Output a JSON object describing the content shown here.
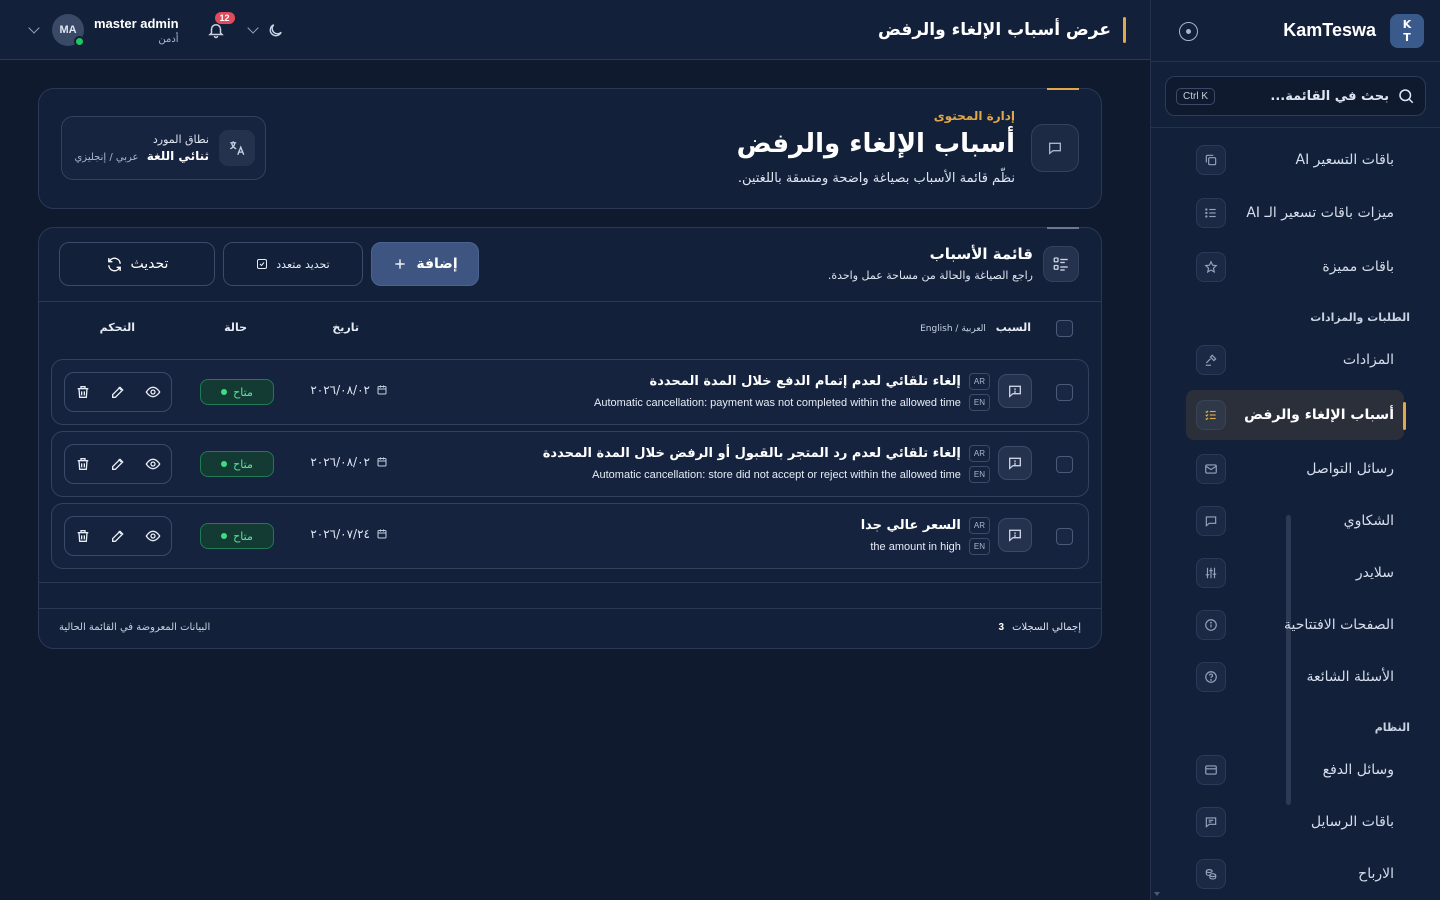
{
  "brand": {
    "logo_line1": "K",
    "logo_line2": "T",
    "name": "KamTeswa"
  },
  "sidebar": {
    "search_placeholder": "بحث في القائمة...",
    "search_shortcut": "Ctrl K",
    "items": [
      {
        "label": "باقات التسعير AI",
        "icon": "copy-icon"
      },
      {
        "label": "ميزات باقات تسعير الـ AI",
        "icon": "list-icon"
      },
      {
        "label": "باقات مميزة",
        "icon": "star-icon"
      },
      {
        "label": "المزادات",
        "icon": "gavel-icon"
      },
      {
        "label": "أسباب الإلغاء والرفض",
        "icon": "list-check-icon",
        "active": true
      },
      {
        "label": "رسائل التواصل",
        "icon": "mail-icon"
      },
      {
        "label": "الشكاوي",
        "icon": "chat-icon"
      },
      {
        "label": "سلايدر",
        "icon": "sliders-icon"
      },
      {
        "label": "الصفحات الافتتاحية",
        "icon": "info-icon"
      },
      {
        "label": "الأسئلة الشائعة",
        "icon": "question-icon"
      },
      {
        "label": "وسائل الدفع",
        "icon": "card-icon"
      },
      {
        "label": "باقات الرسايل",
        "icon": "message-icon"
      },
      {
        "label": "الارباح",
        "icon": "coins-icon"
      }
    ],
    "sections": {
      "orders": "الطلبات والمزادات",
      "system": "النظام"
    }
  },
  "header": {
    "page_title": "عرض أسباب الإلغاء والرفض",
    "user_name": "master admin",
    "user_role": "أدمن",
    "avatar_initials": "MA",
    "notifications_count": "12"
  },
  "hero": {
    "kicker": "إدارة المحتوى",
    "title": "أسباب الإلغاء والرفض",
    "subtitle": "نظّم قائمة الأسباب بصياغة واضحة ومتسقة باللغتين.",
    "lang_label": "نطاق المورد",
    "lang_value": "ثنائي اللغة",
    "lang_detail": "عربي / إنجليزي"
  },
  "list": {
    "title": "قائمة الأسباب",
    "subtitle": "راجع الصياغة والحالة من مساحة عمل واحدة.",
    "add_label": "إضافة",
    "multi_select_label": "تحديد متعدد",
    "refresh_label": "تحديث",
    "columns": {
      "reason": "السبب",
      "reason_sub": "العربية / English",
      "date": "تاريخ",
      "status": "حالة",
      "control": "التحكم"
    },
    "rows": [
      {
        "ar_tag": "AR",
        "ar": "إلغاء تلقائي لعدم إتمام الدفع خلال المدة المحددة",
        "en_tag": "EN",
        "en": "Automatic cancellation: payment was not completed within the allowed time",
        "date": "٢٠٢٦/٠٨/٠٢",
        "status": "متاح"
      },
      {
        "ar_tag": "AR",
        "ar": "إلغاء تلقائي لعدم رد المتجر بالقبول أو الرفض خلال المدة المحددة",
        "en_tag": "EN",
        "en": "Automatic cancellation: store did not accept or reject within the allowed time",
        "date": "٢٠٢٦/٠٨/٠٢",
        "status": "متاح"
      },
      {
        "ar_tag": "AR",
        "ar": "السعر عالي جدا",
        "en_tag": "EN",
        "en": "the amount in high",
        "date": "٢٠٢٦/٠٧/٢٤",
        "status": "متاح"
      }
    ],
    "footer": {
      "total_label": "إجمالي السجلات",
      "total_value": "3",
      "note": "البيانات المعروضة في القائمة الحالية"
    }
  },
  "colors": {
    "accent": "#e0a847",
    "primary_button": "#3d5580",
    "status_green": "#3ddc84",
    "background": "#0f1a2e",
    "panel": "#13203a"
  }
}
